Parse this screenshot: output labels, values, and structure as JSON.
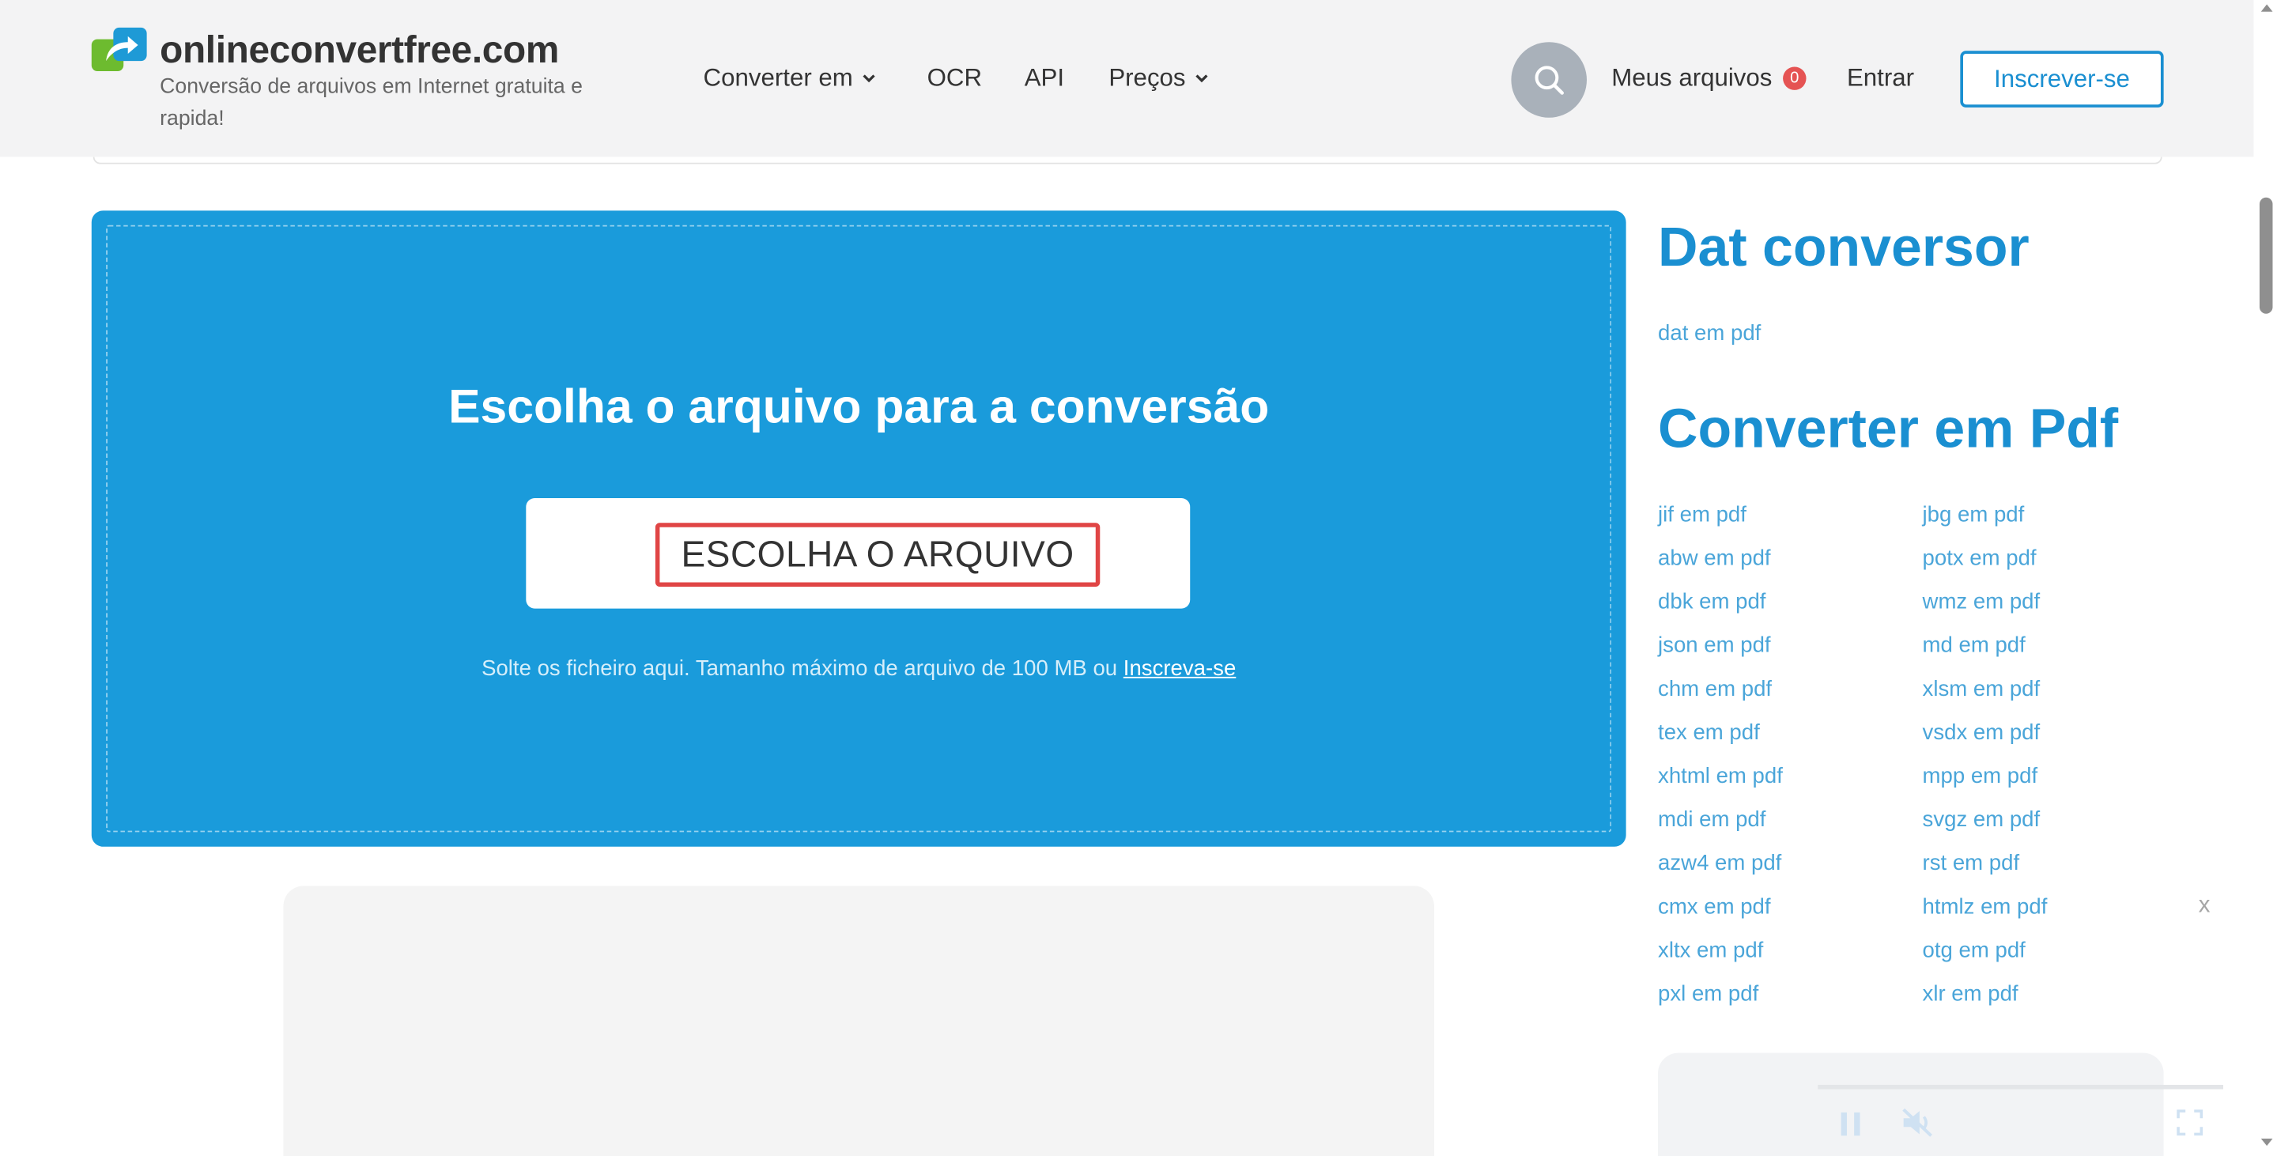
{
  "header": {
    "logo_text": "onlineconvertfree.com",
    "tagline": "Conversão de arquivos em Internet gratuita e rapida!",
    "nav": [
      {
        "label": "Converter em",
        "dropdown": true
      },
      {
        "label": "OCR",
        "dropdown": false
      },
      {
        "label": "API",
        "dropdown": false
      },
      {
        "label": "Preços",
        "dropdown": true
      }
    ],
    "my_files_label": "Meus arquivos",
    "my_files_count": "0",
    "login_label": "Entrar",
    "signup_label": "Inscrever-se"
  },
  "upload": {
    "title": "Escolha o arquivo para a conversão",
    "button_label": "ESCOLHA O ARQUIVO",
    "hint_text": "Solte os ficheiro aqui. Tamanho máximo de arquivo de 100 MB ou",
    "hint_link": "Inscreva-se"
  },
  "sidebar": {
    "dat_heading": "Dat conversor",
    "dat_links": [
      "dat em pdf"
    ],
    "pdf_heading": "Converter em Pdf",
    "pdf_links_col1": [
      "jif em pdf",
      "abw em pdf",
      "dbk em pdf",
      "json em pdf",
      "chm em pdf",
      "tex em pdf",
      "xhtml em pdf",
      "mdi em pdf",
      "azw4 em pdf",
      "cmx em pdf",
      "xltx em pdf",
      "pxl em pdf"
    ],
    "pdf_links_col2": [
      "jbg em pdf",
      "potx em pdf",
      "wmz em pdf",
      "md em pdf",
      "xlsm em pdf",
      "vsdx em pdf",
      "mpp em pdf",
      "svgz em pdf",
      "rst em pdf",
      "htmlz em pdf",
      "otg em pdf",
      "xlr em pdf"
    ]
  },
  "ad_close_label": "x",
  "colors": {
    "accent": "#1a9bdb",
    "link": "#1a8fd1",
    "badge": "#e55353",
    "highlight": "#e04545"
  },
  "icons": {
    "search": "search-icon",
    "logo": "logo-arrow-icon",
    "dropdown": "chevron-down-icon",
    "pause": "pause-icon",
    "mute": "muted-speaker-icon",
    "fullscreen": "fullscreen-icon"
  }
}
